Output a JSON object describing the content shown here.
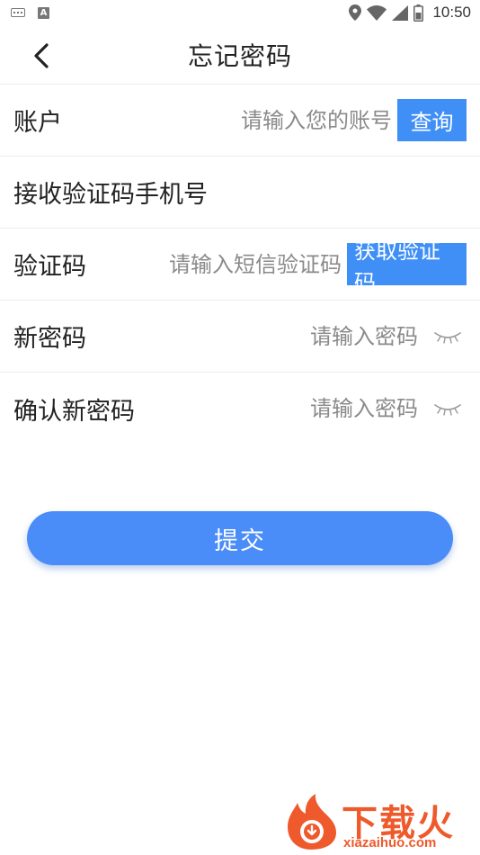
{
  "status_bar": {
    "time": "10:50",
    "icons": [
      "keyboard-icon",
      "text-input-icon",
      "location-icon",
      "wifi-icon",
      "signal-icon",
      "battery-icon"
    ]
  },
  "header": {
    "title": "忘记密码",
    "back_icon": "chevron-left-icon"
  },
  "form": {
    "account": {
      "label": "账户",
      "placeholder": "请输入您的账号",
      "value": "",
      "query_button": "查询"
    },
    "phone": {
      "label": "接收验证码手机号"
    },
    "code": {
      "label": "验证码",
      "placeholder": "请输入短信验证码",
      "value": "",
      "get_code_button": "获取验证码"
    },
    "new_password": {
      "label": "新密码",
      "placeholder": "请输入密码",
      "value": "",
      "toggle_icon": "eye-closed-icon"
    },
    "confirm_password": {
      "label": "确认新密码",
      "placeholder": "请输入密码",
      "value": "",
      "toggle_icon": "eye-closed-icon"
    }
  },
  "submit_label": "提交",
  "watermark": {
    "brand": "下载火",
    "domain": "xiazaihuo.com"
  },
  "colors": {
    "accent": "#3f8ff6",
    "submit": "#4a8cf8",
    "watermark": "#ee5a2c"
  }
}
